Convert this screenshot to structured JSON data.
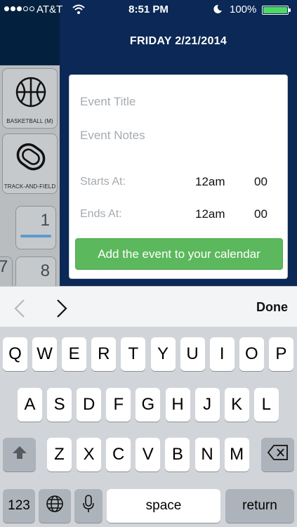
{
  "status_bar": {
    "carrier": "AT&T",
    "time": "8:51 PM",
    "battery": "100%",
    "signal_bars_filled": 3,
    "signal_bars_total": 5,
    "battery_level": 1.0
  },
  "sidebar": {
    "sports": [
      {
        "label": "BASKETBALL (M)",
        "icon": "basketball-icon"
      },
      {
        "label": "TRACK-AND-FIELD",
        "icon": "running-track-icon"
      }
    ],
    "calendar_days": [
      "1",
      "8"
    ],
    "edge_day": "7"
  },
  "header": {
    "date_title": "FRIDAY 2/21/2014"
  },
  "event_form": {
    "title_placeholder": "Event Title",
    "notes_placeholder": "Event Notes",
    "starts_label": "Starts At:",
    "starts_hour": "12am",
    "starts_minute": "00",
    "ends_label": "Ends At:",
    "ends_hour": "12am",
    "ends_minute": "00",
    "add_button_label": "Add the event to your calendar",
    "add_button_color": "#5cb85c"
  },
  "accessory_bar": {
    "done_label": "Done"
  },
  "keyboard": {
    "row1": [
      "Q",
      "W",
      "E",
      "R",
      "T",
      "Y",
      "U",
      "I",
      "O",
      "P"
    ],
    "row2": [
      "A",
      "S",
      "D",
      "F",
      "G",
      "H",
      "J",
      "K",
      "L"
    ],
    "row3": [
      "Z",
      "X",
      "C",
      "V",
      "B",
      "N",
      "M"
    ],
    "numbers_key": "123",
    "space_key": "space",
    "return_key": "return"
  }
}
